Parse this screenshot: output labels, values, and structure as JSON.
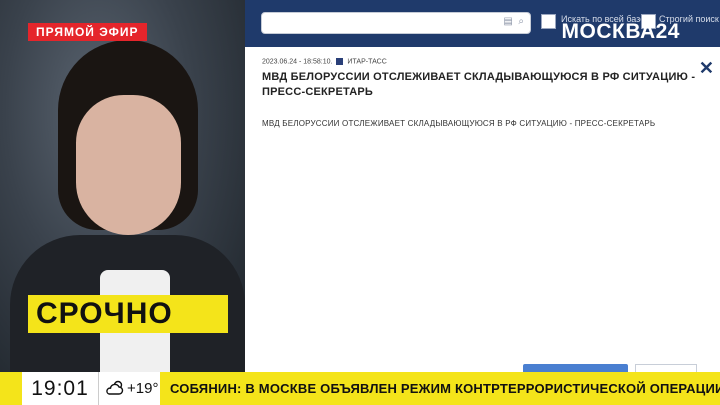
{
  "broadcast": {
    "live_label": "ПРЯМОЙ ЭФИР",
    "urgent_label": "СРОЧНО",
    "channel_logo": "МОСКВА24"
  },
  "screen": {
    "search": {
      "option_1": "Искать по всей базе",
      "option_2": "Строгий поиск"
    },
    "article": {
      "datetime": "2023.06.24 - 18:58:10.",
      "source": "ИТАР-ТАСС",
      "headline": "МВД БЕЛОРУССИИ ОТСЛЕЖИВАЕТ СКЛАДЫВАЮЩУЮСЯ В РФ СИТУАЦИЮ - ПРЕСС-СЕКРЕТАРЬ",
      "body": "МВД БЕЛОРУССИИ ОТСЛЕЖИВАЕТ СКЛАДЫВАЮЩУЮСЯ В РФ СИТУАЦИЮ - ПРЕСС-СЕКРЕТАРЬ"
    }
  },
  "ticker": {
    "time": "19:01",
    "temperature": "+19°",
    "weather_icon": "cloud-sun-icon",
    "text": "СОБЯНИН: В МОСКВЕ ОБЪЯВЛЕН РЕЖИМ КОНТРТЕРРОРИСТИЧЕСКОЙ ОПЕРАЦИИ"
  },
  "colors": {
    "accent_yellow": "#f4e41a",
    "live_red": "#e5252b",
    "header_blue": "#1f3a6b"
  }
}
